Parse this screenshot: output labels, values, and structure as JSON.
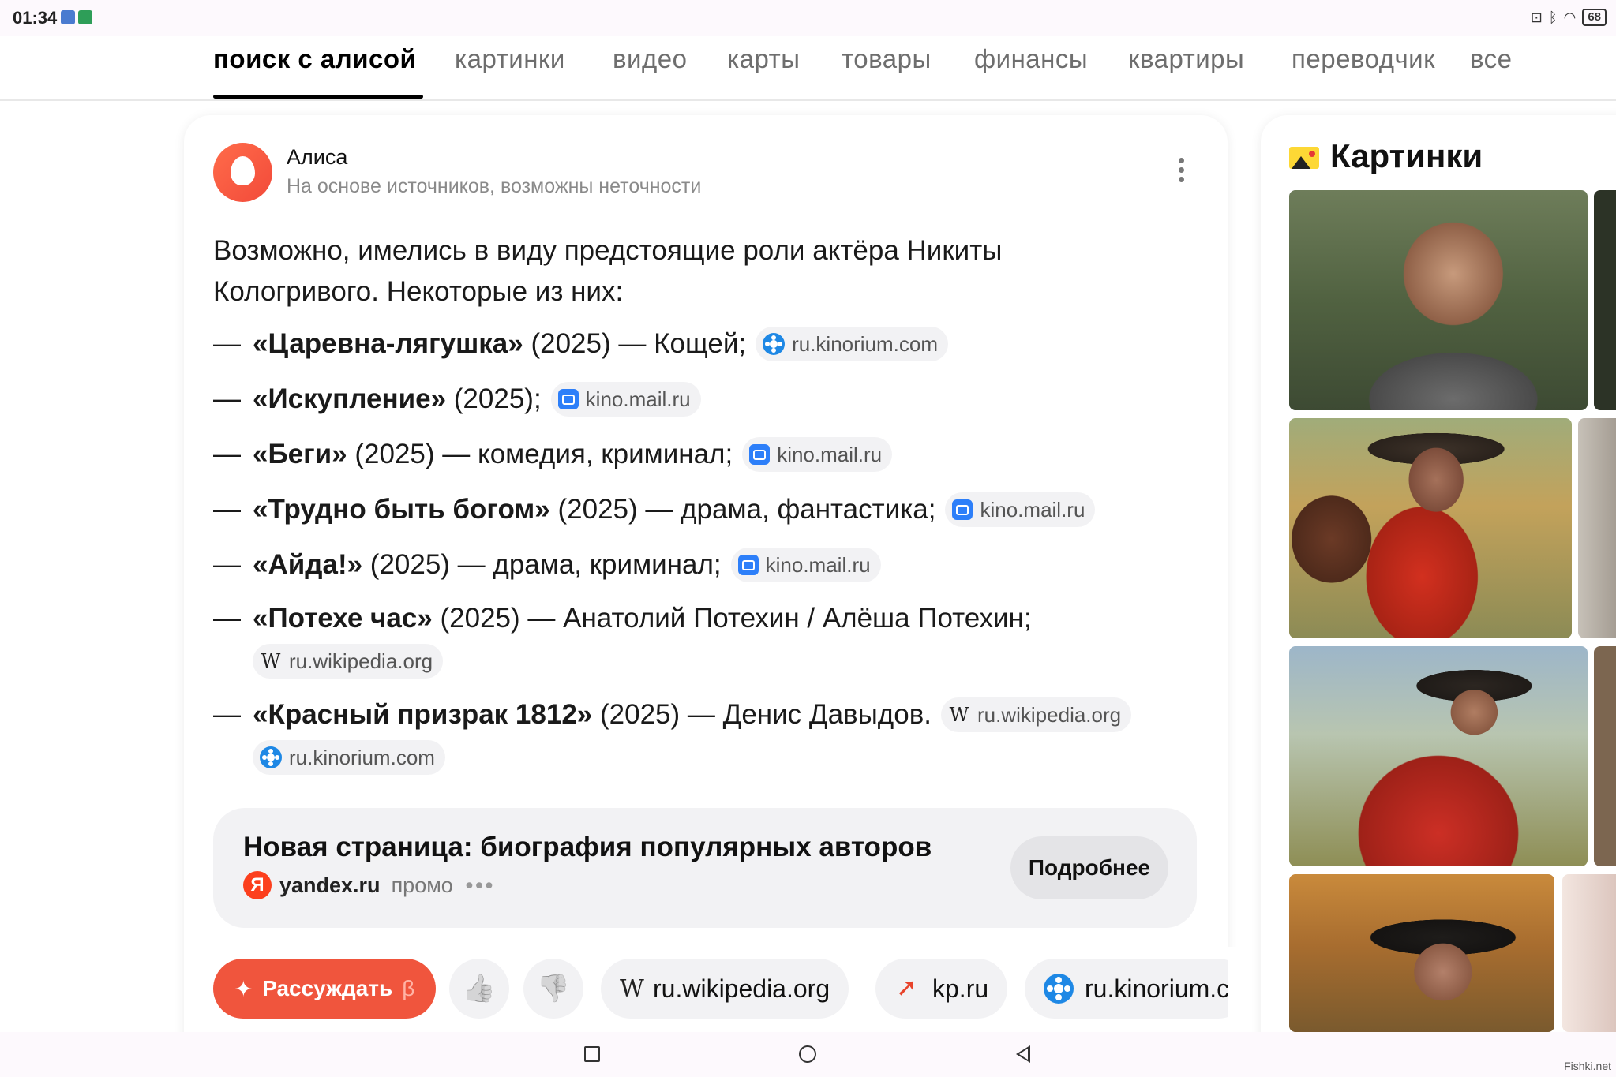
{
  "status_bar": {
    "time": "01:34",
    "battery": "68"
  },
  "tabs": [
    {
      "label": "поиск с  алисой",
      "active": true
    },
    {
      "label": "картинки"
    },
    {
      "label": "видео"
    },
    {
      "label": "карты"
    },
    {
      "label": "товары"
    },
    {
      "label": "финансы"
    },
    {
      "label": "квартиры"
    },
    {
      "label": "переводчик"
    },
    {
      "label": "все"
    }
  ],
  "answer": {
    "author": "Алиса",
    "disclaimer": "На основе источников, возможны неточности",
    "intro": "Возможно, имелись в виду предстоящие роли актёра Никиты Кологривого. Некоторые из них:",
    "items": [
      {
        "dash": "—",
        "title": "«Царевна-лягушка»",
        "rest": " (2025) — Кощей;",
        "sources": [
          "ru.kinorium.com"
        ]
      },
      {
        "dash": "—",
        "title": "«Искупление»",
        "rest": " (2025);",
        "sources": [
          "kino.mail.ru"
        ]
      },
      {
        "dash": "—",
        "title": "«Беги»",
        "rest": " (2025) — комедия, криминал;",
        "sources": [
          "kino.mail.ru"
        ]
      },
      {
        "dash": "—",
        "title": "«Трудно быть богом»",
        "rest": " (2025) — драма, фантастика;",
        "sources": [
          "kino.mail.ru"
        ]
      },
      {
        "dash": "—",
        "title": "«Айда!»",
        "rest": " (2025) — драма, криминал;",
        "sources": [
          "kino.mail.ru"
        ]
      },
      {
        "dash": "—",
        "title": "«Потехе час»",
        "rest": " (2025) — Анатолий Потехин / Алёша Потехин;",
        "sources": [
          "ru.wikipedia.org"
        ]
      },
      {
        "dash": "—",
        "title": "«Красный призрак 1812»",
        "rest": " (2025) — Денис Давыдов.",
        "sources": [
          "ru.wikipedia.org",
          "ru.kinorium.com"
        ]
      }
    ],
    "wiki_glyph": "W"
  },
  "promo": {
    "title": "Новая страница: биография популярных авторов",
    "ya_glyph": "Я",
    "domain": "yandex.ru",
    "tag": "промо",
    "dots": "•••",
    "button": "Подробнее"
  },
  "actions": {
    "reason_label": "Рассуждать",
    "reason_beta": "β",
    "reason_icon": "✦",
    "like_icon": "👍",
    "dislike_icon": "👎",
    "sources": [
      "ru.wikipedia.org",
      "kp.ru",
      "ru.kinorium.c"
    ]
  },
  "side": {
    "title": "Картинки"
  },
  "watermark": "Fishki.net"
}
